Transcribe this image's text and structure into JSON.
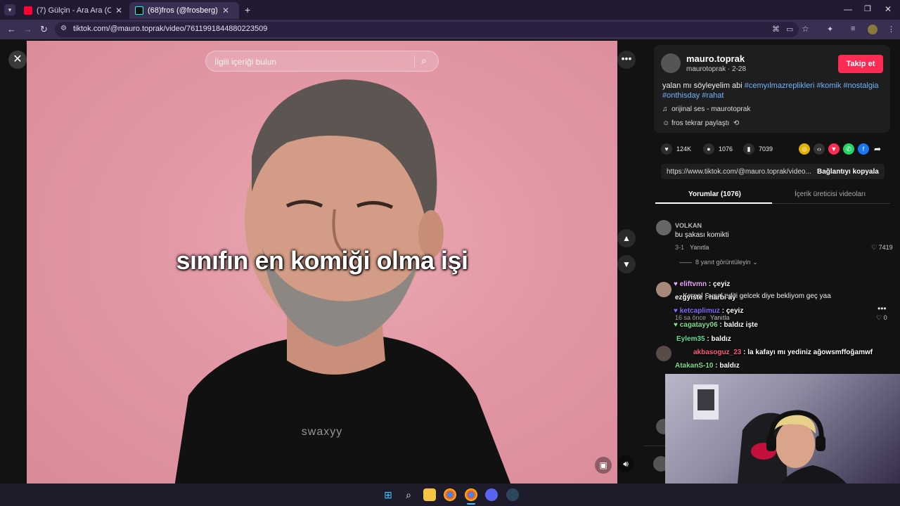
{
  "browser": {
    "tabs": [
      {
        "title": "(7) Gülçin - Ara Ara (Official Vid",
        "active": false
      },
      {
        "title": "(68)fros (@frosberg) | TikTok",
        "active": true
      }
    ],
    "new_tab": "+",
    "url": "tiktok.com/@mauro.toprak/video/7611991844880223509"
  },
  "video": {
    "search_placeholder": "İlgili içeriği bulun",
    "caption": "sınıfın en komiği olma işi",
    "watermark": "swaxyy"
  },
  "author": {
    "name": "mauro.toprak",
    "meta": "maurotoprak · 2-28",
    "follow_label": "Takip et",
    "description_text": "yalan mı söyleyelim abi ",
    "hashtags": [
      "#cemyılmazreplikleri",
      "#komik",
      "#nostalgia",
      "#onthisday",
      "#rahat"
    ],
    "music": "orijinal ses - maurotoprak",
    "repost": "fros tekrar paylaştı"
  },
  "stats": {
    "likes": "124K",
    "comments": "1076",
    "saves": "7039"
  },
  "share": {
    "link": "https://www.tiktok.com/@mauro.toprak/video...",
    "copy_label": "Bağlantıyı kopyala"
  },
  "tabs": {
    "comments": "Yorumlar (1076)",
    "creator_videos": "İçerik üreticisi videoları"
  },
  "comments": [
    {
      "name": "VOLKAN",
      "text": "bu şakası komikti",
      "date": "3-1",
      "reply": "Yanıtla",
      "likes": "7419",
      "view_replies": "8 yanıt görüntüleyin"
    },
    {
      "text": "... Kemal Sunal editi gelcek diye bekliyom geç yaa",
      "date": "16 sa önce",
      "reply": "Yanıtla",
      "likes": "0"
    }
  ],
  "chat": [
    {
      "user": "eliftvmn",
      "msg": "çeyiz",
      "color": "#e8a7ff"
    },
    {
      "user": "ezgyiste",
      "msg": "harbi ay",
      "color": "#ffffff"
    },
    {
      "user": "ketcaplimuz",
      "msg": "çeyiz",
      "color": "#8a6bff"
    },
    {
      "user": "cagatayy06",
      "msg": "baldız işte",
      "color": "#7fe08a"
    },
    {
      "user": "Eylem35",
      "msg": "baldız",
      "color": "#5fe39a"
    },
    {
      "user": "akbasoguz_23",
      "msg": "la kafayı mı yediniz ağowsmffoğamwf",
      "color": "#ff5a7a"
    },
    {
      "user": "AtakanS-10",
      "msg": "baldız",
      "color": "#7fe08a"
    }
  ]
}
